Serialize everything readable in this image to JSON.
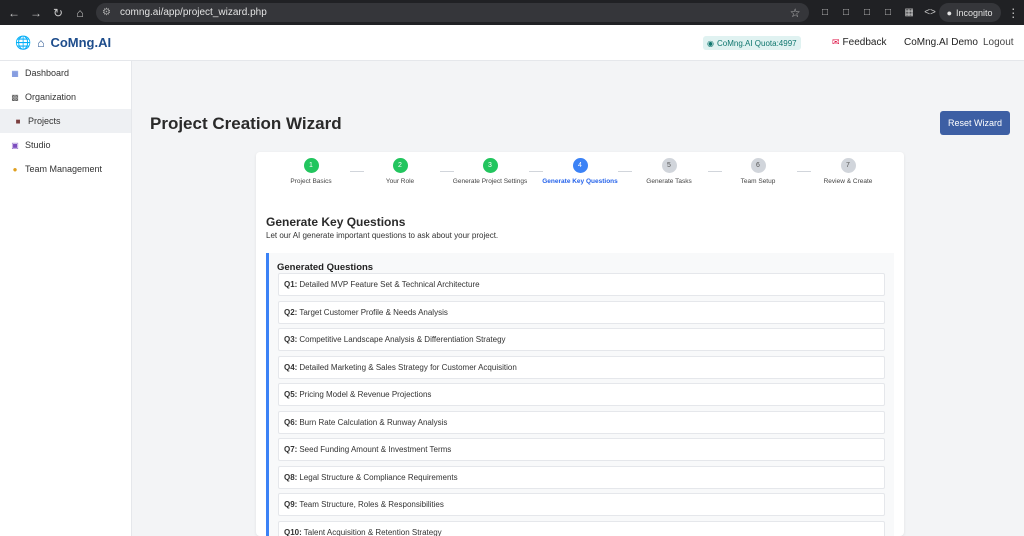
{
  "browser": {
    "url": "comng.ai/app/project_wizard.php",
    "profile_label": "Incognito"
  },
  "header": {
    "brand": "CoMng.AI",
    "quota": "CoMng.AI Quota:4997",
    "feedback": "Feedback",
    "user": "CoMng.AI Demo",
    "logout": "Logout"
  },
  "sidebar": {
    "items": [
      {
        "label": "Dashboard",
        "icon": "dashboard-icon"
      },
      {
        "label": "Organization",
        "icon": "organization-icon"
      },
      {
        "label": "Projects",
        "icon": "briefcase-icon"
      },
      {
        "label": "Studio",
        "icon": "studio-icon"
      },
      {
        "label": "Team Management",
        "icon": "team-icon"
      }
    ],
    "active": "Projects"
  },
  "main": {
    "title": "Project Creation Wizard",
    "reset_label": "Reset Wizard"
  },
  "wizard": {
    "steps": [
      {
        "num": "1",
        "label": "Project Basics",
        "state": "done"
      },
      {
        "num": "2",
        "label": "Your Role",
        "state": "done"
      },
      {
        "num": "3",
        "label": "Generate Project Settings",
        "state": "done"
      },
      {
        "num": "4",
        "label": "Generate Key Questions",
        "state": "current"
      },
      {
        "num": "5",
        "label": "Generate Tasks",
        "state": "pending"
      },
      {
        "num": "6",
        "label": "Team Setup",
        "state": "pending"
      },
      {
        "num": "7",
        "label": "Review & Create",
        "state": "pending"
      }
    ],
    "section_title": "Generate Key Questions",
    "section_subtitle": "Let our AI generate important questions to ask about your project.",
    "generated_header": "Generated Questions",
    "questions": [
      {
        "id": "Q1:",
        "text": "Detailed MVP Feature Set & Technical Architecture"
      },
      {
        "id": "Q2:",
        "text": "Target Customer Profile & Needs Analysis"
      },
      {
        "id": "Q3:",
        "text": "Competitive Landscape Analysis & Differentiation Strategy"
      },
      {
        "id": "Q4:",
        "text": "Detailed Marketing & Sales Strategy for Customer Acquisition"
      },
      {
        "id": "Q5:",
        "text": "Pricing Model & Revenue Projections"
      },
      {
        "id": "Q6:",
        "text": "Burn Rate Calculation & Runway Analysis"
      },
      {
        "id": "Q7:",
        "text": "Seed Funding Amount & Investment Terms"
      },
      {
        "id": "Q8:",
        "text": "Legal Structure & Compliance Requirements"
      },
      {
        "id": "Q9:",
        "text": "Team Structure, Roles & Responsibilities"
      },
      {
        "id": "Q10:",
        "text": "Talent Acquisition & Retention Strategy"
      }
    ]
  },
  "colors": {
    "brand": "#1e4d8c",
    "step_done": "#22c55e",
    "step_current": "#3b82f6",
    "step_pending": "#d1d5db",
    "reset_button": "#3d5fa4"
  }
}
